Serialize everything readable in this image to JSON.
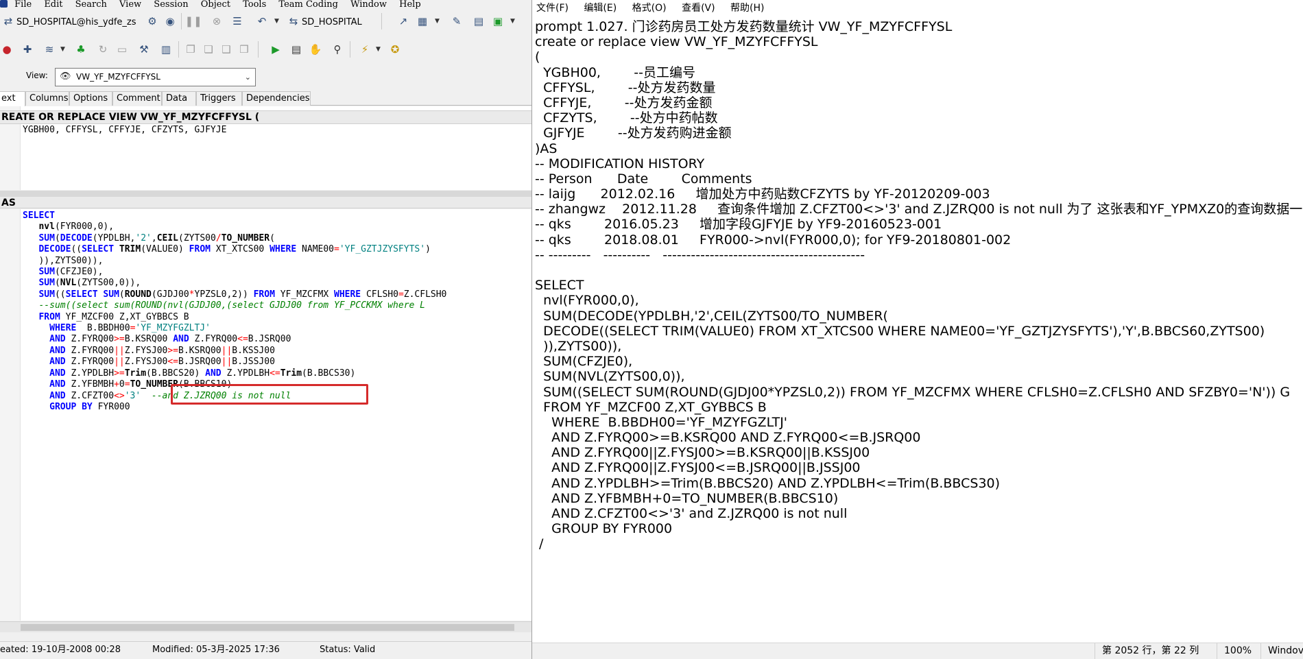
{
  "left": {
    "menu": [
      "File",
      "Edit",
      "Search",
      "View",
      "Session",
      "Object",
      "Tools",
      "Team Coding",
      "Window",
      "Help"
    ],
    "toolbar": {
      "connection": "SD_HOSPITAL@his_ydfe_zs",
      "database": "SD_HOSPITAL"
    },
    "view": {
      "label": "View:",
      "selected": "VW_YF_MZYFCFFYSL"
    },
    "tabs": [
      "ext",
      "Columns",
      "Options",
      "Comment",
      "Data",
      "Triggers",
      "Dependencies"
    ],
    "active_tab": "ext",
    "header_title": "REATE OR REPLACE VIEW VW_YF_MZYFCFFYSL (",
    "header_code": "YGBH00, CFFYSL, CFFYJE, CFZYTS, GJFYJE",
    "as_title": "AS",
    "status": {
      "created": "eated: 19-10月-2008 00:28",
      "modified": "Modified: 05-3月-2025 17:36",
      "status": "Status: Valid"
    }
  },
  "right": {
    "menu": [
      "文件(F)",
      "编辑(E)",
      "格式(O)",
      "查看(V)",
      "帮助(H)"
    ],
    "lines": [
      "prompt 1.027. 门诊药房员工处方发药数量统计 VW_YF_MZYFCFFYSL",
      "create or replace view VW_YF_MZYFCFFYSL",
      "(",
      "  YGBH00,        --员工编号",
      "  CFFYSL,        --处方发药数量",
      "  CFFYJE,        --处方发药金额",
      "  CFZYTS,        --处方中药帖数",
      "  GJFYJE        --处方发药购进金额",
      ")AS",
      "-- MODIFICATION HISTORY",
      "-- Person      Date        Comments",
      "-- laijg      2012.02.16     增加处方中药贴数CFZYTS by YF-20120209-003",
      "-- zhangwz    2012.11.28     查询条件增加 Z.CFZT00<>'3' and Z.JZRQ00 is not null 为了 这张表和YF_YPMXZ0的查询数据一",
      "-- qks        2016.05.23     增加字段GJFYJE by YF9-20160523-001",
      "-- qks        2018.08.01     FYR000->nvl(FYR000,0); for YF9-20180801-002",
      "-- ---------   ----------   -------------------------------------------",
      "",
      "SELECT",
      "  nvl(FYR000,0),",
      "  SUM(DECODE(YPDLBH,'2',CEIL(ZYTS00/TO_NUMBER(",
      "  DECODE((SELECT TRIM(VALUE0) FROM XT_XTCS00 WHERE NAME00='YF_GZTJZYSFYTS'),'Y',B.BBCS60,ZYTS00)",
      "  )),ZYTS00)),",
      "  SUM(CFZJE0),",
      "  SUM(NVL(ZYTS00,0)),",
      "  SUM((SELECT SUM(ROUND(GJDJ00*YPZSL0,2)) FROM YF_MZCFMX WHERE CFLSH0=Z.CFLSH0 AND SFZBY0='N')) G",
      "  FROM YF_MZCF00 Z,XT_GYBBCS B",
      "    WHERE  B.BBDH00='YF_MZYFGZLTJ'",
      "    AND Z.FYRQ00>=B.KSRQ00 AND Z.FYRQ00<=B.JSRQ00",
      "    AND Z.FYRQ00||Z.FYSJ00>=B.KSRQ00||B.KSSJ00",
      "    AND Z.FYRQ00||Z.FYSJ00<=B.JSRQ00||B.JSSJ00",
      "    AND Z.YPDLBH>=Trim(B.BBCS20) AND Z.YPDLBH<=Trim(B.BBCS30)",
      "    AND Z.YFBMBH+0=TO_NUMBER(B.BBCS10)",
      "    AND Z.CFZT00<>'3' and Z.JZRQ00 is not null",
      "    GROUP BY FYR000",
      " /"
    ],
    "status": {
      "position": "第 2052 行，第 22 列",
      "zoom": "100%",
      "eol": "Windov"
    }
  }
}
